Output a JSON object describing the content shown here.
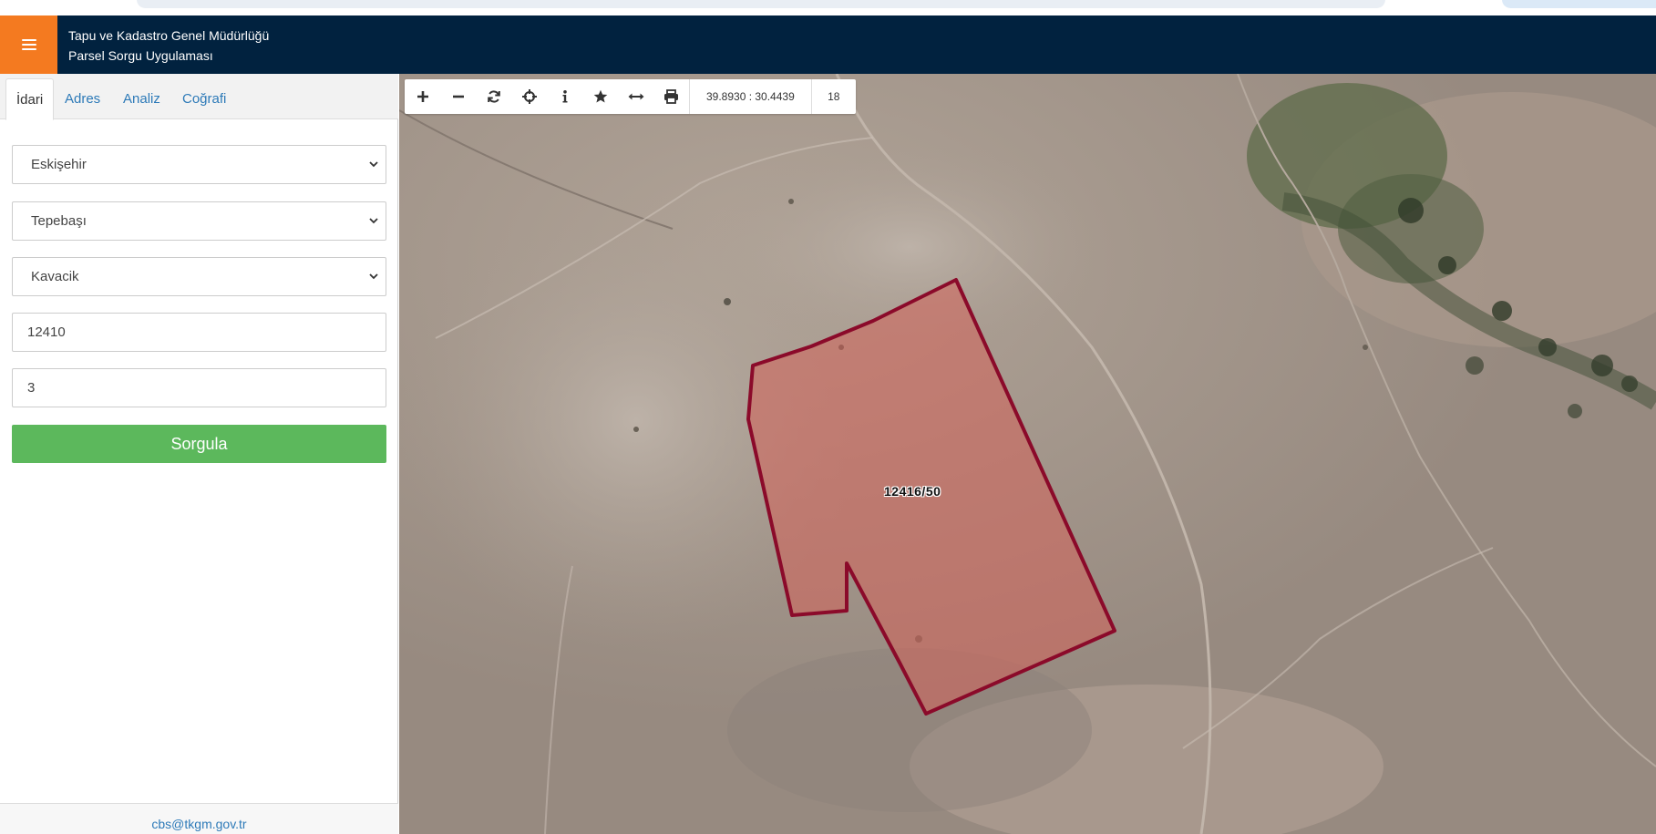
{
  "header": {
    "title_line1": "Tapu ve Kadastro Genel Müdürlüğü",
    "title_line2": "Parsel Sorgu Uygulaması",
    "menu_color": "#f47a20",
    "bg_color": "#01223f"
  },
  "tabs": [
    {
      "label": "İdari",
      "active": true
    },
    {
      "label": "Adres",
      "active": false
    },
    {
      "label": "Analiz",
      "active": false
    },
    {
      "label": "Coğrafi",
      "active": false
    }
  ],
  "form": {
    "province": "Eskişehir",
    "district": "Tepebaşı",
    "neighborhood": "Kavacik",
    "block": "12410",
    "parcel": "3",
    "submit_label": "Sorgula"
  },
  "footer": {
    "email": "cbs@tkgm.gov.tr"
  },
  "map": {
    "coordinates": "39.8930 : 30.4439",
    "zoom_level": "18",
    "parcel_label": "12416/50",
    "parcel_stroke": "#8b0a2a",
    "toolbar_icons": [
      "plus-icon",
      "minus-icon",
      "refresh-icon",
      "crosshair-icon",
      "info-icon",
      "star-icon",
      "measure-icon",
      "print-icon"
    ]
  }
}
